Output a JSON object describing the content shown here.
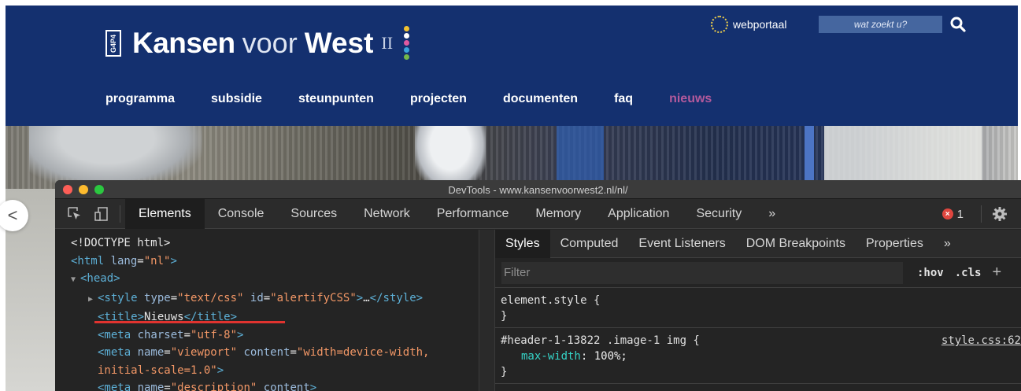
{
  "site": {
    "logo": {
      "badge": "G4P4",
      "kansen": "Kansen",
      "voor": "voor",
      "west": "West",
      "roman": "II"
    },
    "webportaal_label": "webportaal",
    "search_placeholder": "wat zoekt u?",
    "nav": [
      "programma",
      "subsidie",
      "steunpunten",
      "projecten",
      "documenten",
      "faq",
      "nieuws"
    ],
    "active_nav": "nieuws",
    "slider_prev_label": "<"
  },
  "devtools": {
    "window_title": "DevTools - www.kansenvoorwest2.nl/nl/",
    "tabs": [
      "Elements",
      "Console",
      "Sources",
      "Network",
      "Performance",
      "Memory",
      "Application",
      "Security",
      "»"
    ],
    "active_tab": "Elements",
    "error_count": "1",
    "error_glyph": "×",
    "dom_lines": [
      {
        "indent": 0,
        "arrow": "",
        "parts": [
          [
            "tx",
            "<!DOCTYPE html>"
          ]
        ]
      },
      {
        "indent": 0,
        "arrow": "",
        "parts": [
          [
            "tg",
            "<html "
          ],
          [
            "an",
            "lang"
          ],
          [
            "tx",
            "="
          ],
          [
            "av",
            "\"nl\""
          ],
          [
            "tg",
            ">"
          ]
        ]
      },
      {
        "indent": 0,
        "arrow": "▼",
        "parts": [
          [
            "tg",
            "<head>"
          ]
        ]
      },
      {
        "indent": 1,
        "arrow": "▶",
        "parts": [
          [
            "tg",
            "<style "
          ],
          [
            "an",
            "type"
          ],
          [
            "tx",
            "="
          ],
          [
            "av",
            "\"text/css\""
          ],
          [
            "an",
            " id"
          ],
          [
            "tx",
            "="
          ],
          [
            "av",
            "\"alertifyCSS\""
          ],
          [
            "tg",
            ">"
          ],
          [
            "tx",
            "…"
          ],
          [
            "tg",
            "</style>"
          ]
        ]
      },
      {
        "indent": 2,
        "arrow": "",
        "parts": [
          [
            "tg",
            "<title>"
          ],
          [
            "tx",
            "Nieuws"
          ],
          [
            "tg",
            "</title>"
          ]
        ]
      },
      {
        "indent": 2,
        "arrow": "",
        "parts": [
          [
            "tg",
            "<meta "
          ],
          [
            "an",
            "charset"
          ],
          [
            "tx",
            "="
          ],
          [
            "av",
            "\"utf-8\""
          ],
          [
            "tg",
            ">"
          ]
        ]
      },
      {
        "indent": 2,
        "arrow": "",
        "parts": [
          [
            "tg",
            "<meta "
          ],
          [
            "an",
            "name"
          ],
          [
            "tx",
            "="
          ],
          [
            "av",
            "\"viewport\""
          ],
          [
            "an",
            " content"
          ],
          [
            "tx",
            "="
          ],
          [
            "av",
            "\"width=device-width,"
          ]
        ]
      },
      {
        "indent": 2,
        "arrow": "",
        "parts": [
          [
            "av",
            "initial-scale=1.0\""
          ],
          [
            "tg",
            ">"
          ]
        ]
      },
      {
        "indent": 2,
        "arrow": "",
        "parts": [
          [
            "tg",
            "<meta "
          ],
          [
            "an",
            "name"
          ],
          [
            "tx",
            "="
          ],
          [
            "av",
            "\"description\""
          ],
          [
            "an",
            " content"
          ],
          [
            "tg",
            ">"
          ]
        ]
      }
    ],
    "sidebar_tabs": [
      "Styles",
      "Computed",
      "Event Listeners",
      "DOM Breakpoints",
      "Properties",
      "»"
    ],
    "active_sidebar_tab": "Styles",
    "filter_placeholder": "Filter",
    "hov_label": ":hov",
    "cls_label": ".cls",
    "plus_label": "+",
    "rules": [
      {
        "selector": "element.style {",
        "decls": [],
        "close": "}",
        "source": ""
      },
      {
        "selector": "#header-1-13822 .image-1 img {",
        "decls": [
          {
            "name": "max-width",
            "value": "100%;"
          }
        ],
        "close": "}",
        "source": "style.css:62"
      }
    ]
  },
  "colors": {
    "site_header": "#14306f",
    "active_nav": "#b45a9c",
    "devtools_bg": "#242424",
    "traffic_close": "#fd5e57",
    "traffic_min": "#fdbb2e",
    "traffic_max": "#2bc840",
    "annotation_underline": "#e0332f"
  }
}
